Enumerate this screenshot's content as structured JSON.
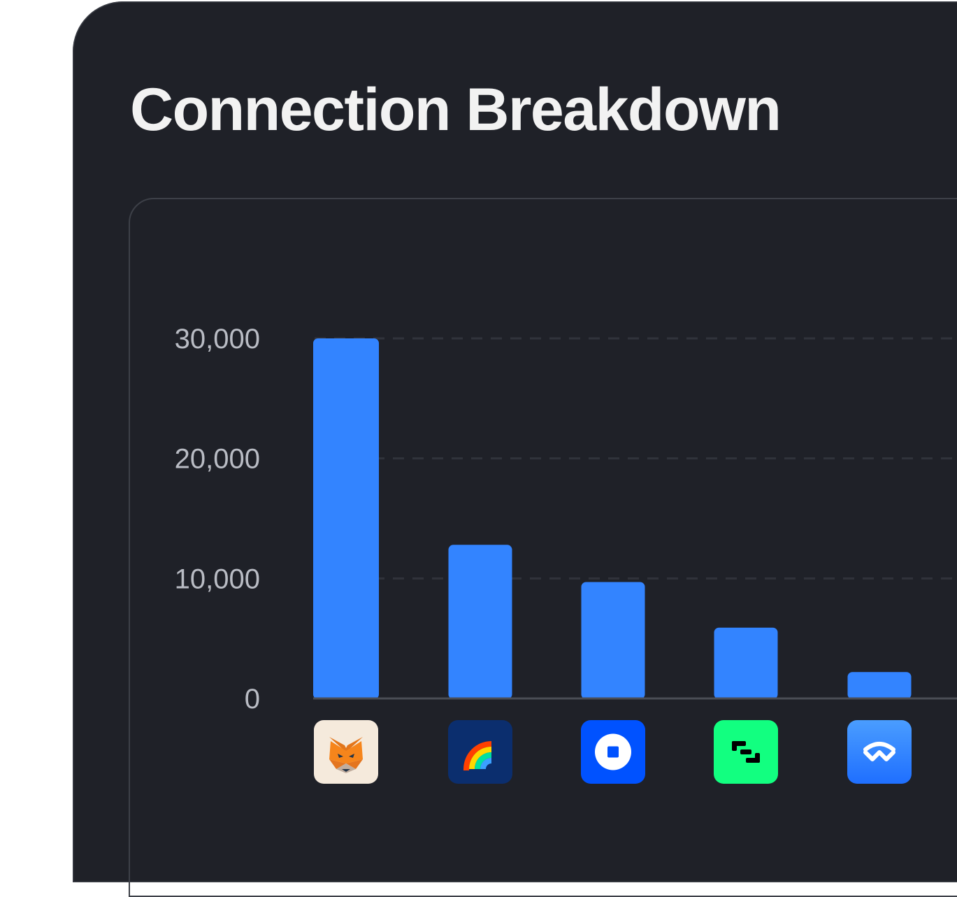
{
  "title": "Connection Breakdown",
  "chart_data": {
    "type": "bar",
    "categories": [
      "metamask-icon",
      "rainbow-icon",
      "coinbase-icon",
      "bitget-icon",
      "walletconnect-icon"
    ],
    "values": [
      30000,
      12800,
      9700,
      5900,
      2200
    ],
    "xlabel": "",
    "ylabel": "",
    "ylim": [
      0,
      30000
    ],
    "yticks": [
      0,
      10000,
      20000,
      30000
    ],
    "ytick_labels": [
      "0",
      "10,000",
      "20,000",
      "30,000"
    ],
    "grid": true,
    "bar_color": "#3384ff"
  },
  "logos": [
    {
      "name": "metamask-icon",
      "bg": "#f5eadc"
    },
    {
      "name": "rainbow-icon",
      "bg": "#0b2e6e"
    },
    {
      "name": "coinbase-icon",
      "bg": "#0052ff"
    },
    {
      "name": "bitget-icon",
      "bg": "#12ff80"
    },
    {
      "name": "walletconnect-icon",
      "bg": "#3b99fc"
    }
  ]
}
